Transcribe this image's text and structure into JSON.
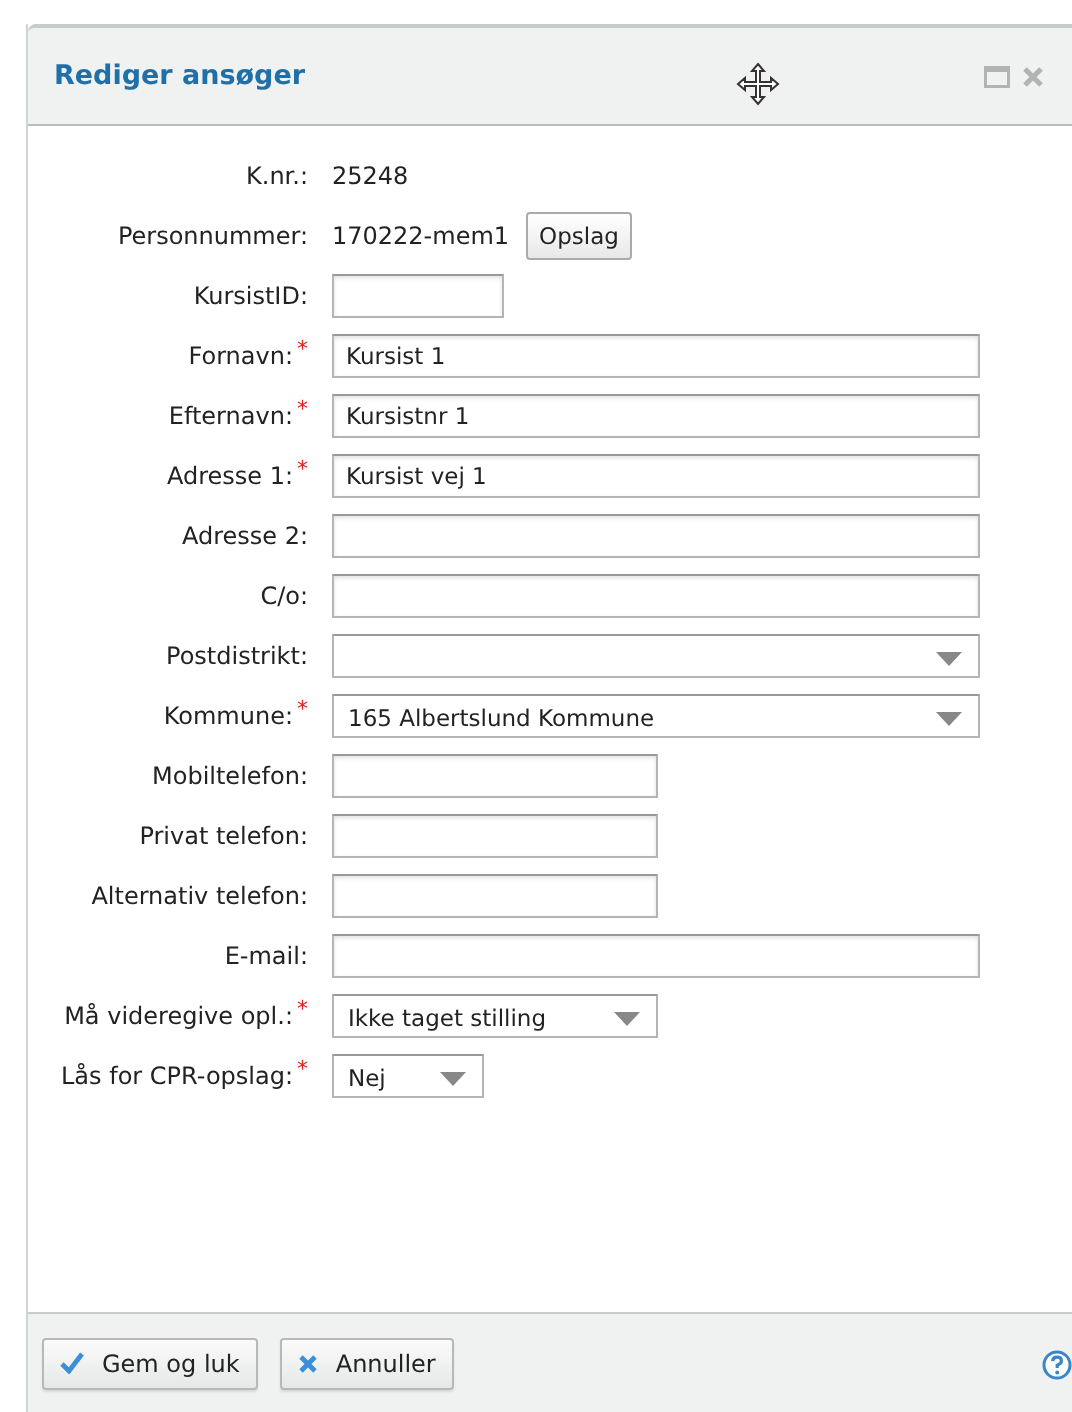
{
  "dialog": {
    "title": "Rediger ansøger"
  },
  "fields": [
    {
      "label": "K.nr.:",
      "kind": "static",
      "value": "25248"
    },
    {
      "label": "Personnummer:",
      "kind": "static-button",
      "value": "170222-mem1",
      "button": "Opslag"
    },
    {
      "label": "KursistID:",
      "kind": "small-input"
    },
    {
      "label": "Fornavn:",
      "required_mark": "*",
      "kind": "wide-input",
      "value": "Kursist 1"
    },
    {
      "label": "Efternavn:",
      "required_mark": "*",
      "kind": "wide-input",
      "value": "Kursistnr 1"
    },
    {
      "label": "Adresse 1:",
      "required_mark": "*",
      "kind": "wide-input",
      "value": "Kursist vej 1"
    },
    {
      "label": "Adresse 2:",
      "kind": "wide-input"
    },
    {
      "label": "C/o:",
      "kind": "wide-input"
    },
    {
      "label": "Postdistrikt:",
      "kind": "wide-select"
    },
    {
      "label": "Kommune:",
      "required_mark": "*",
      "kind": "wide-select",
      "value": "165 Albertslund Kommune"
    },
    {
      "label": "Mobiltelefon:",
      "kind": "medium-input"
    },
    {
      "label": "Privat telefon:",
      "kind": "medium-input"
    },
    {
      "label": "Alternativ telefon:",
      "kind": "medium-input"
    },
    {
      "label": "E-mail:",
      "kind": "wide-input"
    },
    {
      "label": "Må videregive opl.:",
      "required_mark": "*",
      "kind": "medium-select",
      "value": "Ikke taget stilling"
    },
    {
      "label": "Lås for CPR-opslag:",
      "required_mark": "*",
      "kind": "small-select",
      "value": "Nej"
    }
  ],
  "footer": {
    "buttons": [
      {
        "label": "Gem og luk",
        "kind": "confirm"
      },
      {
        "label": "Annuller",
        "kind": "cancel"
      }
    ]
  }
}
